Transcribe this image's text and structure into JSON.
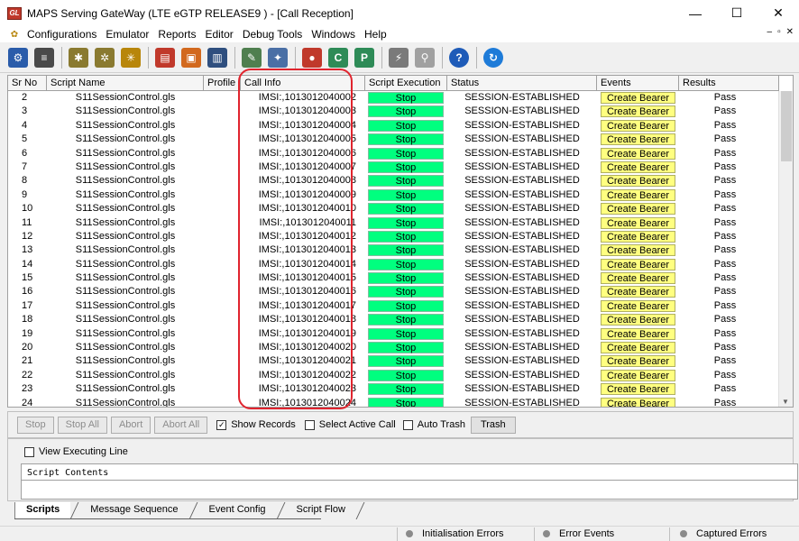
{
  "window": {
    "app_icon_text": "GL",
    "title": "MAPS Serving GateWay (LTE eGTP RELEASE9 ) - [Call Reception]",
    "minimize": "—",
    "maximize": "☐",
    "close": "✕"
  },
  "menu": {
    "items": [
      {
        "label": "Configurations"
      },
      {
        "label": "Emulator"
      },
      {
        "label": "Reports"
      },
      {
        "label": "Editor"
      },
      {
        "label": "Debug Tools"
      },
      {
        "label": "Windows"
      },
      {
        "label": "Help"
      }
    ],
    "mdi_minimize": "–",
    "mdi_restore": "▫",
    "mdi_close": "✕"
  },
  "toolbar": {
    "icons": [
      {
        "name": "settings-gear-icon",
        "color": "#2a5caa",
        "glyph": "⚙"
      },
      {
        "name": "notepad-icon",
        "color": "#4a4a4a",
        "glyph": "≡"
      },
      {
        "name": "profile-gears-icon",
        "color": "#8a7a30",
        "glyph": "✱"
      },
      {
        "name": "gears-icon",
        "color": "#8a7a30",
        "glyph": "✲"
      },
      {
        "name": "gears-yellow-icon",
        "color": "#b8860b",
        "glyph": "✳"
      },
      {
        "name": "database-icon",
        "color": "#c0392b",
        "glyph": "▤"
      },
      {
        "name": "briefcase-icon",
        "color": "#d2691e",
        "glyph": "▣"
      },
      {
        "name": "server-icon",
        "color": "#2f4f7f",
        "glyph": "▥"
      },
      {
        "name": "edit-icon",
        "color": "#4f7f4f",
        "glyph": "✎"
      },
      {
        "name": "tools-icon",
        "color": "#4a6fa5",
        "glyph": "✦"
      },
      {
        "name": "record-red-icon",
        "color": "#c0392b",
        "glyph": "●"
      },
      {
        "name": "record-green-c-icon",
        "color": "#2e8b57",
        "glyph": "C"
      },
      {
        "name": "record-green-p-icon",
        "color": "#2e8b57",
        "glyph": "P"
      },
      {
        "name": "plug-icon",
        "color": "#7a7a7a",
        "glyph": "⚡"
      },
      {
        "name": "plug-disabled-icon",
        "color": "#a0a0a0",
        "glyph": "⚲"
      },
      {
        "name": "help-icon",
        "color": "#1e5bb8",
        "glyph": "?"
      },
      {
        "name": "refresh-icon",
        "color": "#1e7bd8",
        "glyph": "↻"
      }
    ]
  },
  "grid": {
    "columns": [
      "Sr No",
      "Script Name",
      "Profile",
      "Call Info",
      "Script Execution",
      "Status",
      "Events",
      "Results"
    ],
    "rows": [
      {
        "sr": "2",
        "script": "S11SessionControl.gls",
        "profile": "",
        "call": "IMSI:,1013012040002",
        "exec": "Stop",
        "status": "SESSION-ESTABLISHED",
        "event": "Create Bearer",
        "result": "Pass"
      },
      {
        "sr": "3",
        "script": "S11SessionControl.gls",
        "profile": "",
        "call": "IMSI:,1013012040003",
        "exec": "Stop",
        "status": "SESSION-ESTABLISHED",
        "event": "Create Bearer",
        "result": "Pass"
      },
      {
        "sr": "4",
        "script": "S11SessionControl.gls",
        "profile": "",
        "call": "IMSI:,1013012040004",
        "exec": "Stop",
        "status": "SESSION-ESTABLISHED",
        "event": "Create Bearer",
        "result": "Pass"
      },
      {
        "sr": "5",
        "script": "S11SessionControl.gls",
        "profile": "",
        "call": "IMSI:,1013012040005",
        "exec": "Stop",
        "status": "SESSION-ESTABLISHED",
        "event": "Create Bearer",
        "result": "Pass"
      },
      {
        "sr": "6",
        "script": "S11SessionControl.gls",
        "profile": "",
        "call": "IMSI:,1013012040006",
        "exec": "Stop",
        "status": "SESSION-ESTABLISHED",
        "event": "Create Bearer",
        "result": "Pass"
      },
      {
        "sr": "7",
        "script": "S11SessionControl.gls",
        "profile": "",
        "call": "IMSI:,1013012040007",
        "exec": "Stop",
        "status": "SESSION-ESTABLISHED",
        "event": "Create Bearer",
        "result": "Pass"
      },
      {
        "sr": "8",
        "script": "S11SessionControl.gls",
        "profile": "",
        "call": "IMSI:,1013012040008",
        "exec": "Stop",
        "status": "SESSION-ESTABLISHED",
        "event": "Create Bearer",
        "result": "Pass"
      },
      {
        "sr": "9",
        "script": "S11SessionControl.gls",
        "profile": "",
        "call": "IMSI:,1013012040009",
        "exec": "Stop",
        "status": "SESSION-ESTABLISHED",
        "event": "Create Bearer",
        "result": "Pass"
      },
      {
        "sr": "10",
        "script": "S11SessionControl.gls",
        "profile": "",
        "call": "IMSI:,1013012040010",
        "exec": "Stop",
        "status": "SESSION-ESTABLISHED",
        "event": "Create Bearer",
        "result": "Pass"
      },
      {
        "sr": "11",
        "script": "S11SessionControl.gls",
        "profile": "",
        "call": "IMSI:,1013012040011",
        "exec": "Stop",
        "status": "SESSION-ESTABLISHED",
        "event": "Create Bearer",
        "result": "Pass"
      },
      {
        "sr": "12",
        "script": "S11SessionControl.gls",
        "profile": "",
        "call": "IMSI:,1013012040012",
        "exec": "Stop",
        "status": "SESSION-ESTABLISHED",
        "event": "Create Bearer",
        "result": "Pass"
      },
      {
        "sr": "13",
        "script": "S11SessionControl.gls",
        "profile": "",
        "call": "IMSI:,1013012040013",
        "exec": "Stop",
        "status": "SESSION-ESTABLISHED",
        "event": "Create Bearer",
        "result": "Pass"
      },
      {
        "sr": "14",
        "script": "S11SessionControl.gls",
        "profile": "",
        "call": "IMSI:,1013012040014",
        "exec": "Stop",
        "status": "SESSION-ESTABLISHED",
        "event": "Create Bearer",
        "result": "Pass"
      },
      {
        "sr": "15",
        "script": "S11SessionControl.gls",
        "profile": "",
        "call": "IMSI:,1013012040015",
        "exec": "Stop",
        "status": "SESSION-ESTABLISHED",
        "event": "Create Bearer",
        "result": "Pass"
      },
      {
        "sr": "16",
        "script": "S11SessionControl.gls",
        "profile": "",
        "call": "IMSI:,1013012040016",
        "exec": "Stop",
        "status": "SESSION-ESTABLISHED",
        "event": "Create Bearer",
        "result": "Pass"
      },
      {
        "sr": "17",
        "script": "S11SessionControl.gls",
        "profile": "",
        "call": "IMSI:,1013012040017",
        "exec": "Stop",
        "status": "SESSION-ESTABLISHED",
        "event": "Create Bearer",
        "result": "Pass"
      },
      {
        "sr": "18",
        "script": "S11SessionControl.gls",
        "profile": "",
        "call": "IMSI:,1013012040018",
        "exec": "Stop",
        "status": "SESSION-ESTABLISHED",
        "event": "Create Bearer",
        "result": "Pass"
      },
      {
        "sr": "19",
        "script": "S11SessionControl.gls",
        "profile": "",
        "call": "IMSI:,1013012040019",
        "exec": "Stop",
        "status": "SESSION-ESTABLISHED",
        "event": "Create Bearer",
        "result": "Pass"
      },
      {
        "sr": "20",
        "script": "S11SessionControl.gls",
        "profile": "",
        "call": "IMSI:,1013012040020",
        "exec": "Stop",
        "status": "SESSION-ESTABLISHED",
        "event": "Create Bearer",
        "result": "Pass"
      },
      {
        "sr": "21",
        "script": "S11SessionControl.gls",
        "profile": "",
        "call": "IMSI:,1013012040021",
        "exec": "Stop",
        "status": "SESSION-ESTABLISHED",
        "event": "Create Bearer",
        "result": "Pass"
      },
      {
        "sr": "22",
        "script": "S11SessionControl.gls",
        "profile": "",
        "call": "IMSI:,1013012040022",
        "exec": "Stop",
        "status": "SESSION-ESTABLISHED",
        "event": "Create Bearer",
        "result": "Pass"
      },
      {
        "sr": "23",
        "script": "S11SessionControl.gls",
        "profile": "",
        "call": "IMSI:,1013012040023",
        "exec": "Stop",
        "status": "SESSION-ESTABLISHED",
        "event": "Create Bearer",
        "result": "Pass"
      },
      {
        "sr": "24",
        "script": "S11SessionControl.gls",
        "profile": "",
        "call": "IMSI:,1013012040024",
        "exec": "Stop",
        "status": "SESSION-ESTABLISHED",
        "event": "Create Bearer",
        "result": "Pass"
      }
    ],
    "colors": {
      "stop_bg": "#00ff7f",
      "bearer_bg": "#ffff80",
      "highlight": "#e0242e"
    }
  },
  "controls": {
    "stop": "Stop",
    "stop_all": "Stop All",
    "abort": "Abort",
    "abort_all": "Abort All",
    "show_records": {
      "label": "Show Records",
      "checked": true
    },
    "select_active_call": {
      "label": "Select Active Call",
      "checked": false
    },
    "auto_trash": {
      "label": "Auto Trash",
      "checked": false
    },
    "trash": "Trash"
  },
  "exec_panel": {
    "view_executing_line": "View Executing Line",
    "script_contents": "Script Contents"
  },
  "tabs": [
    {
      "label": "Scripts",
      "active": true
    },
    {
      "label": "Message Sequence",
      "active": false
    },
    {
      "label": "Event Config",
      "active": false
    },
    {
      "label": "Script Flow",
      "active": false
    }
  ],
  "statusbar": {
    "init_errors": "Initialisation Errors",
    "error_events": "Error Events",
    "captured_errors": "Captured Errors"
  }
}
